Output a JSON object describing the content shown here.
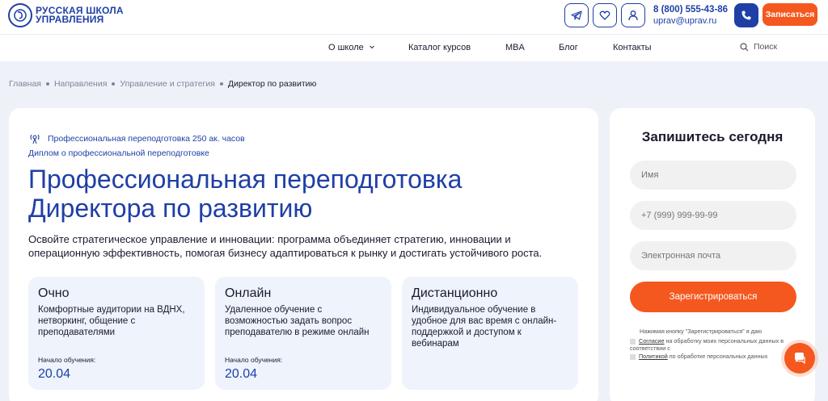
{
  "header": {
    "logo_line1": "РУССКАЯ ШКОЛА",
    "logo_line2": "УПРАВЛЕНИЯ",
    "phone": "8 (800) 555-43-86",
    "email": "uprav@uprav.ru",
    "signup_label": "Записаться",
    "icons": [
      "telegram-icon",
      "heart-icon",
      "user-icon",
      "phone-icon"
    ]
  },
  "nav": {
    "items": [
      "О школе",
      "Каталог курсов",
      "MBA",
      "Блог",
      "Контакты"
    ],
    "search_placeholder": "Поиск"
  },
  "breadcrumb": [
    "Главная",
    "Направления",
    "Управление и стратегия",
    "Директор по развитию"
  ],
  "course": {
    "tag": "Профессиональная переподготовка 250 ак. часов",
    "diploma": "Диплом о профессиональной переподготовке",
    "title_line1": "Профессиональная переподготовка",
    "title_line2": "Директора по развитию",
    "description": "Освойте стратегическое управление и инновации: программа объединяет стратегию, инновации и операционную эффективность, помогая бизнесу адаптироваться к рынку и достигать устойчивого роста.",
    "formats": [
      {
        "name": "Очно",
        "text": "Комфортные аудитории на ВДНХ, нетворкинг, общение с преподавателями",
        "start_label": "Начало обучения:",
        "start_date": "20.04"
      },
      {
        "name": "Онлайн",
        "text": "Удаленное обучение с возможностью задать вопрос преподавателю в режиме онлайн",
        "start_label": "Начало обучения:",
        "start_date": "20.04"
      },
      {
        "name": "Дистанционно",
        "text": "Индивидуальное обучение в удобное для вас время с онлайн-поддержкой и доступом к вебинарам"
      }
    ]
  },
  "form": {
    "title": "Запишитесь сегодня",
    "name_placeholder": "Имя",
    "phone_placeholder": "+7 (999) 999-99-99",
    "email_placeholder": "Электронная почта",
    "submit_label": "Зарегистрироваться",
    "consent_intro": "Нажимая кнопку \"Зарегистрироваться\" я даю",
    "consent1_link": "Согласие",
    "consent1_text": " на обработку моих персональных данных в соответствии с",
    "consent2_link": "Политикой",
    "consent2_text": " по обработке персональных данных"
  },
  "colors": {
    "brand_blue": "#1f3fa6",
    "accent_orange": "#f4581f"
  }
}
